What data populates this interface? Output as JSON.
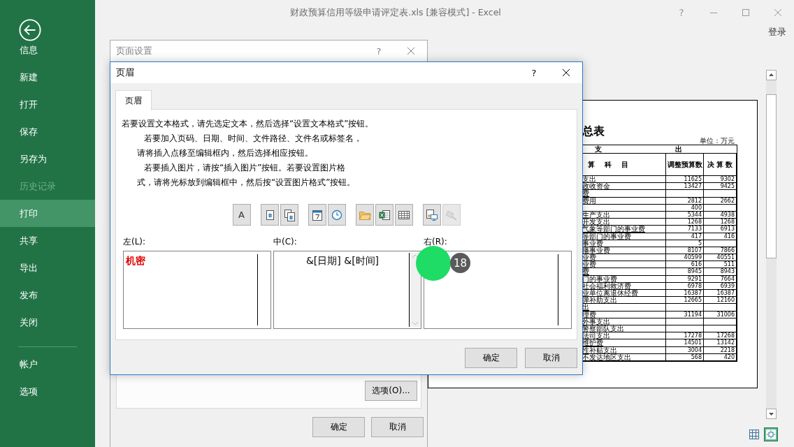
{
  "window": {
    "title": "财政预算信用等级申请评定表.xls  [兼容模式] - Excel",
    "controls": [
      {
        "kind": "help",
        "label": "?"
      },
      {
        "kind": "minimize"
      },
      {
        "kind": "maximize"
      },
      {
        "kind": "close"
      }
    ],
    "sign_in": "登录"
  },
  "backstage": {
    "items": [
      {
        "label": "信息",
        "selected": false,
        "disabled": false
      },
      {
        "label": "新建",
        "selected": false,
        "disabled": false
      },
      {
        "label": "打开",
        "selected": false,
        "disabled": false
      },
      {
        "label": "保存",
        "selected": false,
        "disabled": false
      },
      {
        "label": "另存为",
        "selected": false,
        "disabled": false
      },
      {
        "label": "历史记录",
        "selected": false,
        "disabled": true
      },
      {
        "label": "打印",
        "selected": true,
        "disabled": false
      },
      {
        "label": "共享",
        "selected": false,
        "disabled": false
      },
      {
        "label": "导出",
        "selected": false,
        "disabled": false
      },
      {
        "label": "发布",
        "selected": false,
        "disabled": false
      },
      {
        "label": "关闭",
        "selected": false,
        "disabled": false
      }
    ],
    "bottom_items": [
      {
        "label": "帐户",
        "selected": false,
        "disabled": false
      },
      {
        "label": "选项",
        "selected": false,
        "disabled": false
      }
    ]
  },
  "preview": {
    "title": "总表",
    "unit": "单位：万元",
    "header_top": [
      "支",
      "出"
    ],
    "columns": [
      "算    科    目",
      "调整预算数",
      "决 算 数"
    ],
    "rows": [
      [
        "支出",
        "11625",
        "9302"
      ],
      [
        "政收资金",
        "13427",
        "9425"
      ],
      [
        "费",
        "",
        ""
      ],
      [
        "费用",
        "2812",
        "2662"
      ],
      [
        "",
        "400",
        ""
      ],
      [
        "生产支出",
        "5344",
        "4938"
      ],
      [
        "开发支出",
        "1268",
        "1268"
      ],
      [
        "气象等部门的事业费",
        "7133",
        "6913"
      ],
      [
        "等部门的事业费",
        "417",
        "416"
      ],
      [
        "事业费",
        "5",
        ""
      ],
      [
        "播事业费",
        "8107",
        "7866"
      ],
      [
        "业费",
        "40599",
        "40551"
      ],
      [
        "业费",
        "616",
        "511"
      ],
      [
        "费",
        "8945",
        "8943"
      ],
      [
        "门的事业费",
        "9291",
        "7664"
      ],
      [
        "社会福利救济费",
        "6978",
        "6939"
      ],
      [
        "业单位离退休经费",
        "16387",
        "16387"
      ],
      [
        "弹补助支出",
        "12665",
        "12160"
      ],
      [
        "出",
        "",
        ""
      ],
      [
        "理费",
        "31194",
        "31006"
      ],
      [
        "外事支出",
        "",
        ""
      ],
      [
        "警察部队支出",
        "",
        ""
      ],
      [
        "法司支出",
        "17278",
        "17268"
      ],
      [
        "维护费",
        "14501",
        "13142"
      ],
      [
        "性补贴支出",
        "3004",
        "2218"
      ],
      [
        "不发达地区支出",
        "568",
        "420"
      ]
    ]
  },
  "view_buttons": [
    {
      "kind": "normal",
      "selected": false
    },
    {
      "kind": "margins",
      "selected": true
    }
  ],
  "page_setup_dialog": {
    "title": "页面设置",
    "help": "?",
    "options_button": "选项(O)...",
    "buttons": [
      "确定",
      "取消"
    ]
  },
  "header_dialog": {
    "title": "页眉",
    "help": "?",
    "tabs": [
      {
        "label": "页眉",
        "selected": true
      }
    ],
    "instructions": [
      "若要设置文本格式，请先选定文本，然后选择“设置文本格式”按钮。",
      "若要加入页码、日期、时间、文件路径、文件名或标签名，",
      "请将插入点移至编辑框内，然后选择相应按钮。",
      "若要插入图片，请按“插入图片”按钮。若要设置图片格",
      "式，请将光标放到编辑框中，然后按“设置图片格式”按钮。"
    ],
    "tools": [
      {
        "kind": "text",
        "label": "A",
        "disabled": false
      },
      {
        "kind": "page-number",
        "disabled": false
      },
      {
        "kind": "page-count",
        "disabled": false
      },
      {
        "kind": "date",
        "disabled": false
      },
      {
        "kind": "time",
        "disabled": false
      },
      {
        "kind": "file-path",
        "disabled": false
      },
      {
        "kind": "file-name",
        "disabled": false
      },
      {
        "kind": "sheet-name",
        "disabled": false
      },
      {
        "kind": "picture",
        "disabled": false
      },
      {
        "kind": "format-picture",
        "disabled": true
      }
    ],
    "sections": [
      {
        "label": "左(L):",
        "value": "机密",
        "kind": "plain",
        "color": "#e00000",
        "bold": true
      },
      {
        "label": "中(C):",
        "value": "&[日期] &[时间]",
        "kind": "scrolling",
        "color": "#000000",
        "bold": false
      },
      {
        "label": "右(R):",
        "kind": "plain"
      }
    ],
    "buttons": [
      "确定",
      "取消"
    ]
  },
  "step_marker": "18"
}
